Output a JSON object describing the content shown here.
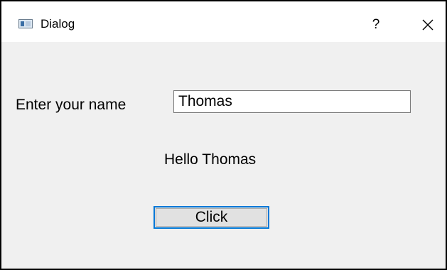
{
  "window": {
    "title": "Dialog",
    "help_label": "?",
    "close_icon": "close-icon",
    "app_icon": "window-app-icon"
  },
  "form": {
    "name_label": "Enter your name",
    "name_value": "Thomas",
    "greeting": "Hello Thomas",
    "button_label": "Click"
  },
  "colors": {
    "client_background": "#f0f0f0",
    "titlebar_background": "#ffffff",
    "button_focus_border": "#0078d7",
    "button_face": "#e1e1e1"
  }
}
